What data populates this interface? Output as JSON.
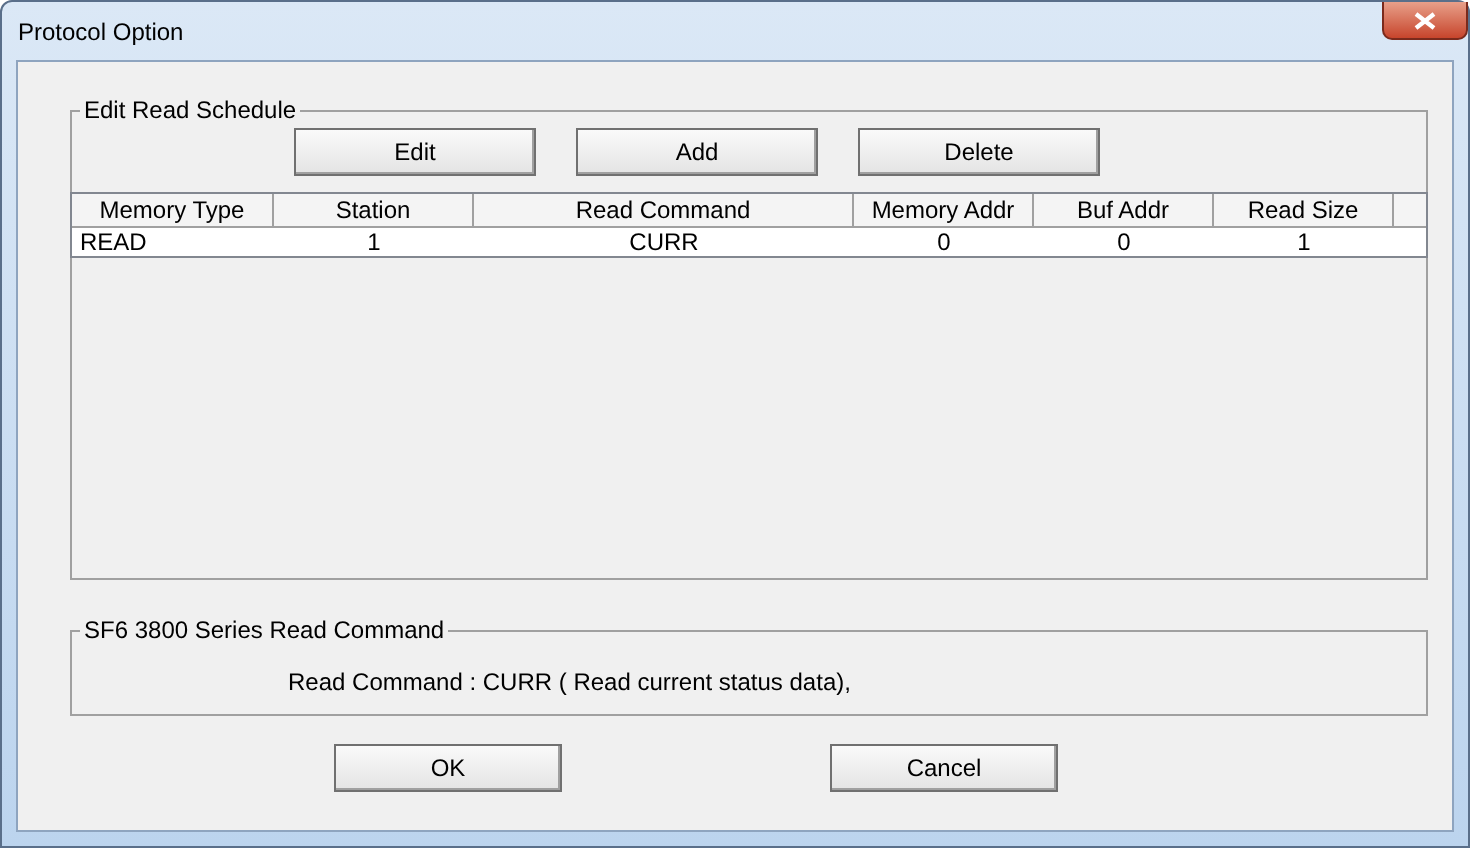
{
  "window": {
    "title": "Protocol Option"
  },
  "schedule": {
    "title": "Edit Read Schedule",
    "buttons": [
      "Edit",
      "Add",
      "Delete"
    ],
    "table": {
      "columns": [
        "Memory Type",
        "Station",
        "Read Command",
        "Memory Addr",
        "Buf Addr",
        "Read Size"
      ],
      "rows": [
        [
          "READ",
          "1",
          "CURR",
          "0",
          "0",
          "1"
        ]
      ]
    }
  },
  "command_info": {
    "title": "SF6 3800 Series Read Command",
    "text": "Read Command : CURR ( Read current status data),"
  },
  "buttons": [
    "OK",
    "Cancel"
  ]
}
